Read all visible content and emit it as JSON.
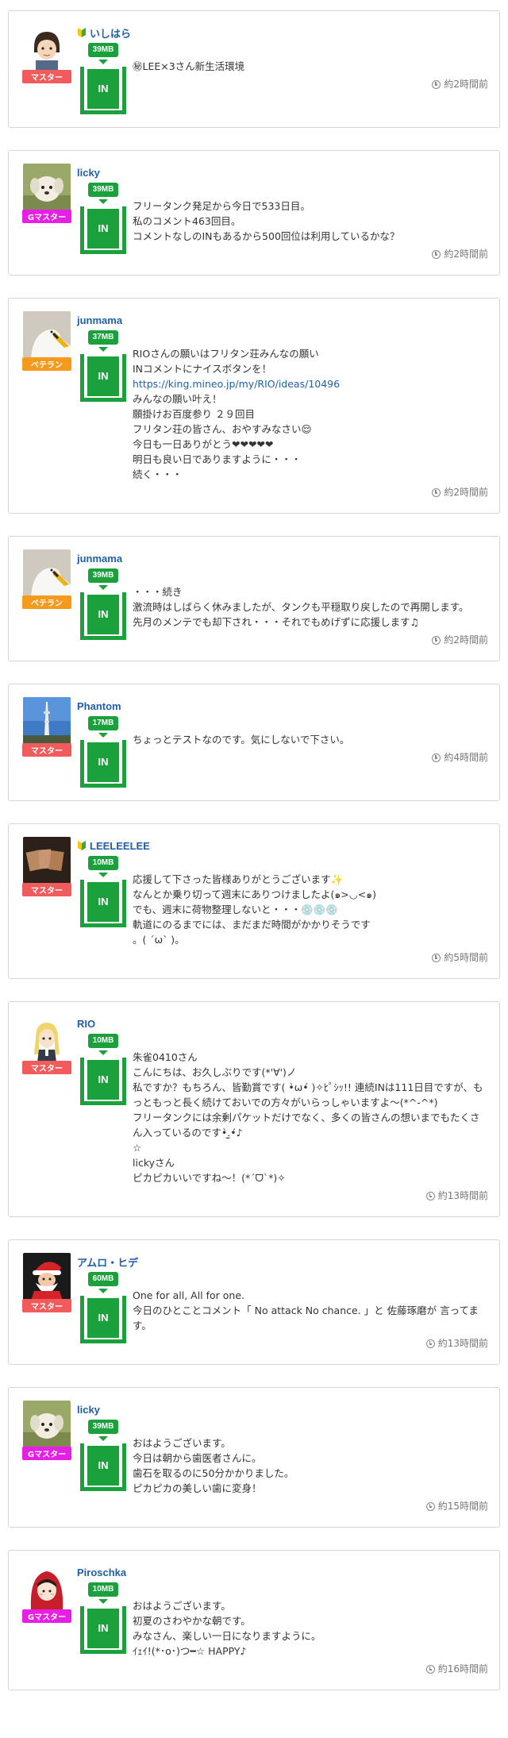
{
  "colors": {
    "tank_green": "#1aa13c",
    "username_blue": "#1f5fa8",
    "badge_master": "#f15b5b",
    "badge_gmaster": "#e61ee6",
    "badge_veteran": "#f59a1d"
  },
  "posts": [
    {
      "username": "いしはら",
      "beginner": true,
      "avatar": "anime-boy",
      "badge": "マスター",
      "badge_type": "master",
      "mb": "39MB",
      "tank_label": "IN",
      "lines": [
        "㊙LEE×3さん新生活環境"
      ],
      "time": "約2時間前"
    },
    {
      "username": "licky",
      "beginner": false,
      "avatar": "dog",
      "badge": "Gマスター",
      "badge_type": "gmaster",
      "mb": "39MB",
      "tank_label": "IN",
      "lines": [
        "フリータンク発足から今日で533日目。",
        "私のコメント463回目。",
        "コメントなしのINもあるから500回位は利用しているかな？"
      ],
      "time": "約2時間前"
    },
    {
      "username": "junmama",
      "beginner": false,
      "avatar": "swan",
      "badge": "ベテラン",
      "badge_type": "veteran",
      "mb": "37MB",
      "tank_label": "IN",
      "lines": [
        "RIOさんの願いはフリタン荘みんなの願い",
        "INコメントにナイスボタンを！",
        "https://king.mineo.jp/my/RIO/ideas/10496",
        "みんなの願い叶え！",
        "願掛けお百度参り ２９回目",
        "フリタン荘の皆さん、おやすみなさい😌",
        "今日も一日ありがとう❤❤❤❤❤",
        "明日も良い日でありますように・・・",
        "続く・・・"
      ],
      "link_index": 2,
      "time": "約2時間前"
    },
    {
      "username": "junmama",
      "beginner": false,
      "avatar": "swan",
      "badge": "ベテラン",
      "badge_type": "veteran",
      "mb": "39MB",
      "tank_label": "IN",
      "lines": [
        "・・・続き",
        "激流時はしばらく休みましたが、タンクも平穏取り戻したので再開します。",
        "先月のメンテでも却下され・・・それでもめげずに応援します♫"
      ],
      "time": "約2時間前"
    },
    {
      "username": "Phantom",
      "beginner": false,
      "avatar": "tower",
      "badge": "マスター",
      "badge_type": "master",
      "mb": "17MB",
      "tank_label": "IN",
      "lines": [
        "ちょっとテストなのです。気にしないで下さい。"
      ],
      "time": "約4時間前"
    },
    {
      "username": "LEELEELEE",
      "beginner": true,
      "avatar": "cards",
      "badge": "マスター",
      "badge_type": "master",
      "mb": "10MB",
      "tank_label": "IN",
      "lines": [
        "応援して下さった皆様ありがとうございます✨",
        "なんとか乗り切って週末にありつけましたよ(๑>◡<๑)",
        "でも、週末に荷物整理しないと・・・💿💿💿",
        "軌道にのるまでには、まだまだ時間がかかりそうです",
        "。( ´ω` )。"
      ],
      "time": "約5時間前"
    },
    {
      "username": "RIO",
      "beginner": false,
      "avatar": "girl",
      "badge": "マスター",
      "badge_type": "master",
      "mb": "10MB",
      "tank_label": "IN",
      "lines": [
        "朱雀0410さん",
        "こんにちは、お久しぶりです(*'∀')ノ",
        "私ですか？もちろん、皆勤賞です( •̀ω•́ )✧ﾋﾟｼｯ!! 連続INは111日目ですが、もっともっと長く続けておいでの方々がいらっしゃいますよ〜(*^-^*)",
        "フリータンクには余剰パケットだけでなく、多くの皆さんの想いまでもたくさん入っているのです•̀.̫•́♪",
        "☆",
        "lickyさん",
        "ピカピカいいですね〜！(*´ᗜ`*)✧"
      ],
      "time": "約13時間前"
    },
    {
      "username": "アムロ・ヒデ",
      "beginner": false,
      "avatar": "santa",
      "badge": "マスター",
      "badge_type": "master",
      "mb": "60MB",
      "tank_label": "IN",
      "lines": [
        "One for all, All for one.",
        "今日のひとことコメント「 No attack No chance. 」と 佐藤琢磨が 言ってます。"
      ],
      "time": "約13時間前"
    },
    {
      "username": "licky",
      "beginner": false,
      "avatar": "dog",
      "badge": "Gマスター",
      "badge_type": "gmaster",
      "mb": "39MB",
      "tank_label": "IN",
      "lines": [
        "おはようございます。",
        "今日は朝から歯医者さんに。",
        "歯石を取るのに50分かかりました。",
        "ピカピカの美しい歯に変身！"
      ],
      "time": "約15時間前"
    },
    {
      "username": "Piroschka",
      "beginner": false,
      "avatar": "hood-girl",
      "badge": "Gマスター",
      "badge_type": "gmaster",
      "mb": "10MB",
      "tank_label": "IN",
      "lines": [
        "おはようございます。",
        "初夏のさわやかな朝です。",
        "みなさん、楽しい一日になりますように。",
        "ｲｪｲ!(*･o･)つ━☆ HAPPY♪"
      ],
      "time": "約16時間前"
    }
  ]
}
